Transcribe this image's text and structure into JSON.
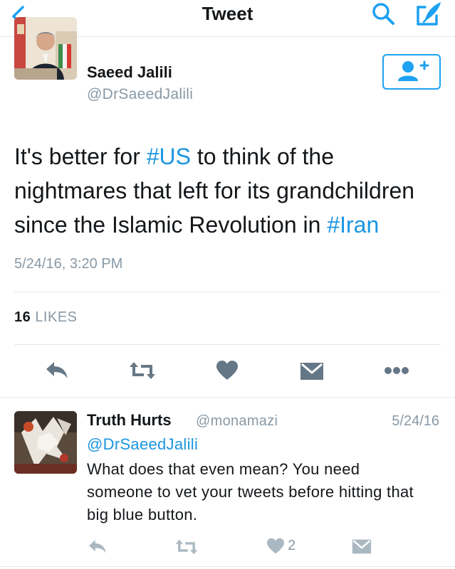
{
  "header": {
    "title": "Tweet",
    "icons": [
      "back-chevron-icon",
      "search-icon",
      "compose-icon"
    ]
  },
  "tweet": {
    "author_name": "Saeed Jalili",
    "author_handle": "@DrSaeedJalili",
    "text_parts": [
      "It's better for ",
      "#US",
      " to think of the nightmares that left for its grandchildren since the Islamic Revolution in ",
      "#Iran"
    ],
    "timestamp": "5/24/16, 3:20 PM",
    "likes_count": "16",
    "likes_label": "LIKES"
  },
  "reply": {
    "author_name": "Truth Hurts",
    "author_handle": "@monamazi",
    "date": "5/24/16",
    "mention": "@DrSaeedJalili",
    "text": "What does that even mean? You need someone to vet your tweets before hitting that big blue button.",
    "likes_count": "2"
  },
  "colors": {
    "accent": "#1da1f2",
    "link": "#1b95e0",
    "muted": "#8899a6",
    "icon_gray": "#657786",
    "divider": "#e1e8ed"
  }
}
